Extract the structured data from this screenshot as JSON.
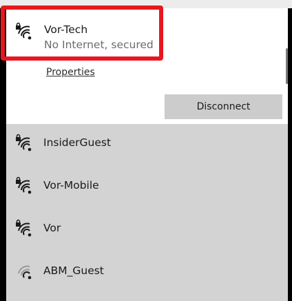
{
  "connected_network": {
    "name": "Vor-Tech",
    "status": "No Internet, secured",
    "icon": "wifi-secured-icon",
    "properties_label": "Properties",
    "disconnect_label": "Disconnect"
  },
  "available_networks": [
    {
      "name": "InsiderGuest",
      "icon": "wifi-secured-icon"
    },
    {
      "name": "Vor-Mobile",
      "icon": "wifi-secured-icon"
    },
    {
      "name": "Vor",
      "icon": "wifi-secured-icon"
    },
    {
      "name": "ABM_Guest",
      "icon": "wifi-weak-icon"
    }
  ],
  "colors": {
    "highlight": "#e8171f",
    "connected_bg": "#ffffff",
    "list_bg": "#d3d3d3",
    "button_bg": "#cccccc"
  }
}
